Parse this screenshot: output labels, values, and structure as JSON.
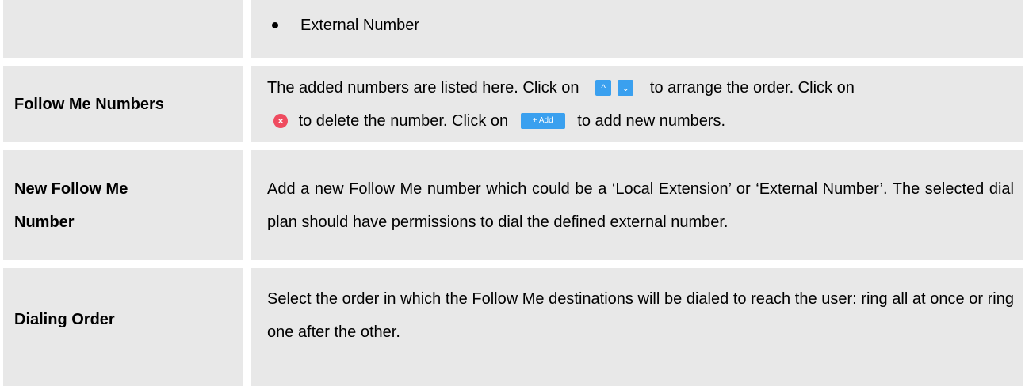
{
  "rows": [
    {
      "label": "",
      "bullet": "External Number"
    },
    {
      "label": "Follow Me Numbers",
      "desc_part1": "The added numbers are listed here. Click on",
      "desc_part2": "to arrange the order. Click on",
      "desc_part3": "to delete the number. Click on",
      "desc_part4": "to add new numbers.",
      "up_glyph": "^",
      "down_glyph": "⌄",
      "delete_glyph": "×",
      "add_label": "+ Add"
    },
    {
      "label_line1": "New Follow Me",
      "label_line2": "Number",
      "desc": "Add a new Follow Me number which could be a ‘Local Extension’ or ‘External Number’. The selected dial plan should have permissions to dial the defined external number."
    },
    {
      "label": "Dialing Order",
      "desc": "Select the order in which the Follow Me destinations will be dialed to reach the user: ring all at once or ring one after the other."
    }
  ],
  "colors": {
    "row_bg": "#e8e8e8",
    "button_blue": "#3aa0ef",
    "delete_red": "#ef4b5f"
  },
  "icons": [
    "arrow-up-icon",
    "arrow-down-icon",
    "delete-icon",
    "add-icon"
  ]
}
